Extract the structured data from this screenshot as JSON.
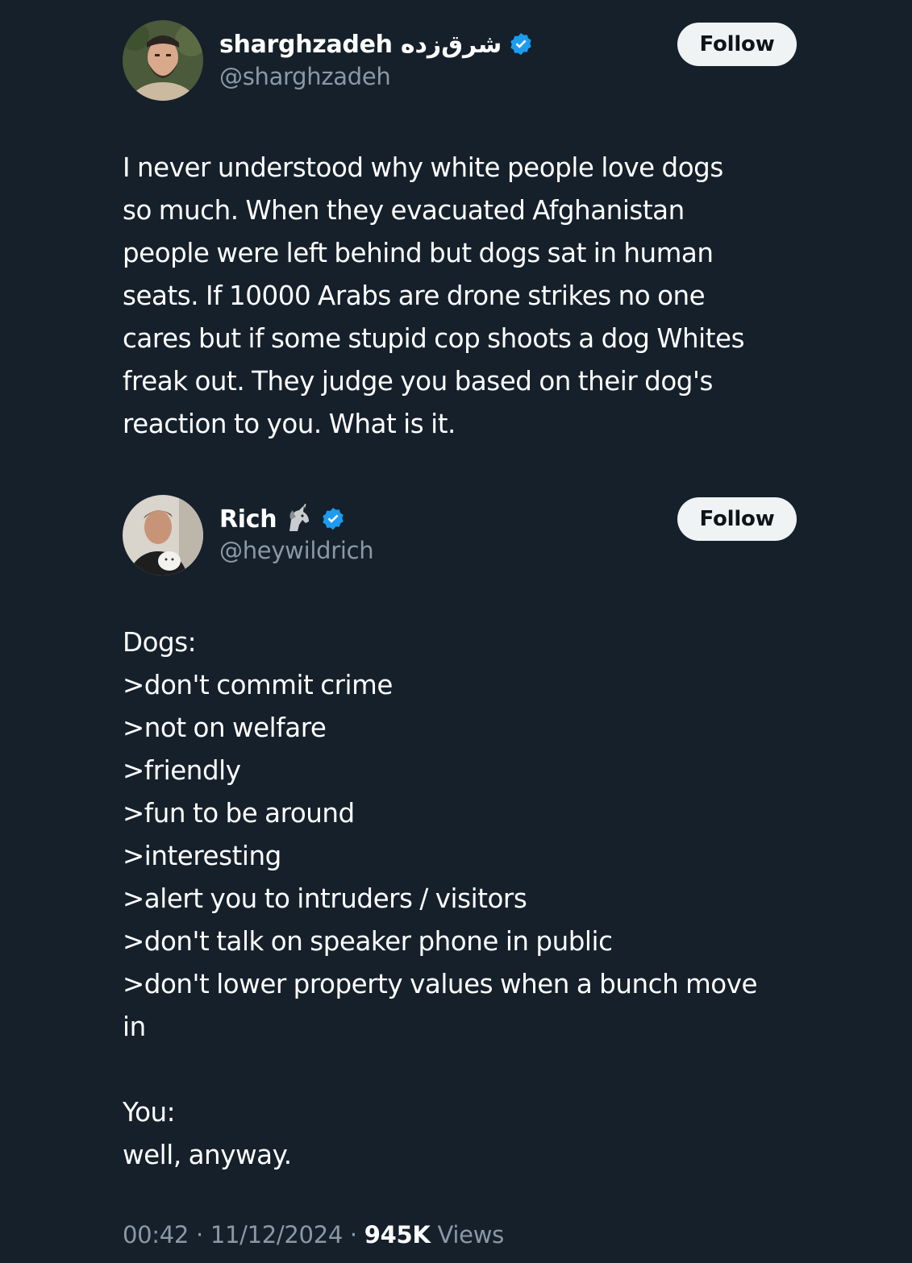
{
  "tweet1": {
    "display_name": "sharghzadeh شرق‌زده",
    "handle": "@sharghzadeh",
    "follow_label": "Follow",
    "text_lines": [
      "I never understood why white people love dogs",
      "so much. When they evacuated Afghanistan",
      "people were left behind but dogs sat in human",
      "seats. If 10000 Arabs are drone strikes no one",
      "cares but if some stupid cop shoots a dog Whites",
      "freak out. They judge you based on their dog's",
      "reaction to you. What is it."
    ]
  },
  "tweet2": {
    "display_name": "Rich",
    "handle": "@heywildrich",
    "follow_label": "Follow",
    "text_lines": [
      "Dogs:",
      ">don't commit crime",
      ">not on welfare",
      ">friendly",
      ">fun to be around",
      ">interesting",
      ">alert you to intruders / visitors",
      ">don't talk on speaker phone in public",
      ">don't lower property values when a bunch move",
      "in",
      "",
      "You:",
      "well, anyway."
    ],
    "time": "00:42",
    "date": "11/12/2024",
    "views_count": "945K",
    "views_label": "Views"
  },
  "icons": {
    "verified": "verified-badge-icon",
    "unicorn": "unicorn-emoji-icon"
  },
  "colors": {
    "background": "#15202b",
    "text_primary": "#ffffff",
    "text_secondary": "#8b98a5",
    "verified_blue": "#1d9bf0",
    "follow_bg": "#eff3f4",
    "follow_text": "#0f1419"
  }
}
